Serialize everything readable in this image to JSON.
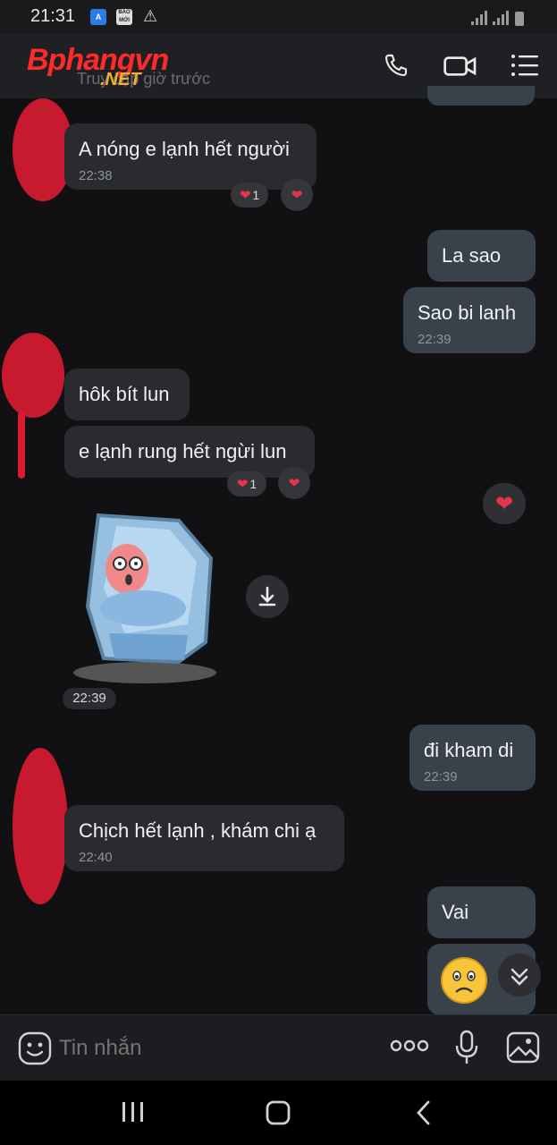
{
  "status_bar": {
    "time": "21:31",
    "app_badge_1": "A",
    "app_badge_2": "BÁO MỚI"
  },
  "header": {
    "watermark_main": "Bphangvn",
    "watermark_sub": ".NET",
    "subtitle": "Truy cập giờ trước"
  },
  "messages": [
    {
      "side": "in",
      "text": "A nóng e lạnh hết người",
      "time": "22:38",
      "reaction_count": "1"
    },
    {
      "side": "out",
      "text": "La sao"
    },
    {
      "side": "out",
      "text": "Sao bi lanh",
      "time": "22:39"
    },
    {
      "side": "in",
      "text": "hôk bít lun"
    },
    {
      "side": "in",
      "text": "e lạnh rung hết ngừi lun",
      "reaction_count": "1"
    },
    {
      "side": "in",
      "type": "sticker",
      "time": "22:39"
    },
    {
      "side": "out",
      "text": "đi kham di",
      "time": "22:39"
    },
    {
      "side": "in",
      "text": "Chịch hết lạnh , khám chi ạ",
      "time": "22:40"
    },
    {
      "side": "out",
      "text": "Vai"
    },
    {
      "side": "out",
      "type": "emoji"
    }
  ],
  "composer": {
    "placeholder": "Tin nhắn"
  },
  "colors": {
    "background": "#111113",
    "incoming_bubble": "#2a2b2e",
    "outgoing_bubble": "#39414b",
    "heart": "#e7344e"
  },
  "icons": [
    "phone-icon",
    "video-icon",
    "menu-icon",
    "download-icon",
    "scroll-down-icon",
    "emoji-icon",
    "more-icon",
    "mic-icon",
    "image-icon"
  ]
}
